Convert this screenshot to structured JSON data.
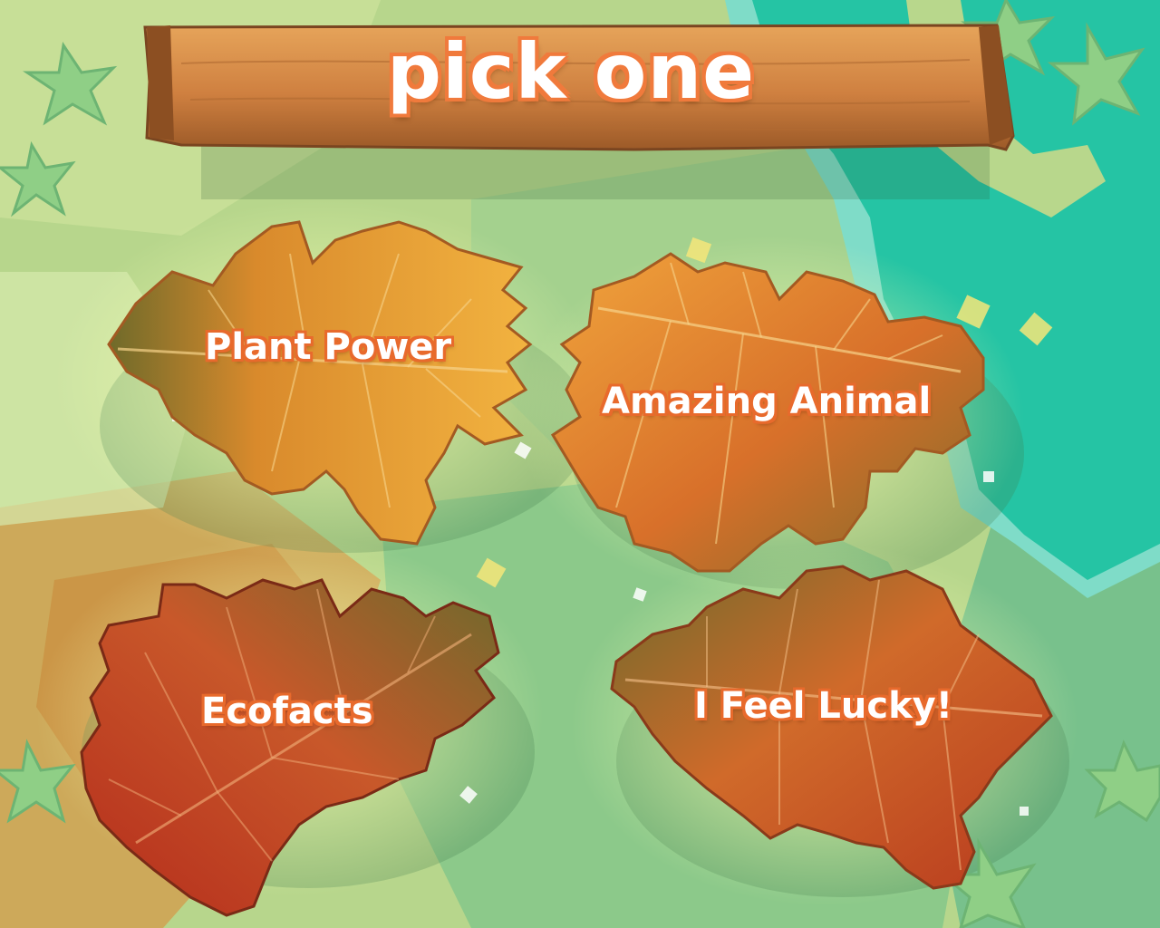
{
  "screen": {
    "title": "pick one"
  },
  "options": [
    {
      "label": "Plant Power"
    },
    {
      "label": "Amazing Animal"
    },
    {
      "label": "Ecofacts"
    },
    {
      "label": "I Feel Lucky!"
    }
  ],
  "colors": {
    "outline": "#e86a2c",
    "water": "#25c4a4",
    "grass": "#b9d98f",
    "wood": "#d58a45"
  }
}
